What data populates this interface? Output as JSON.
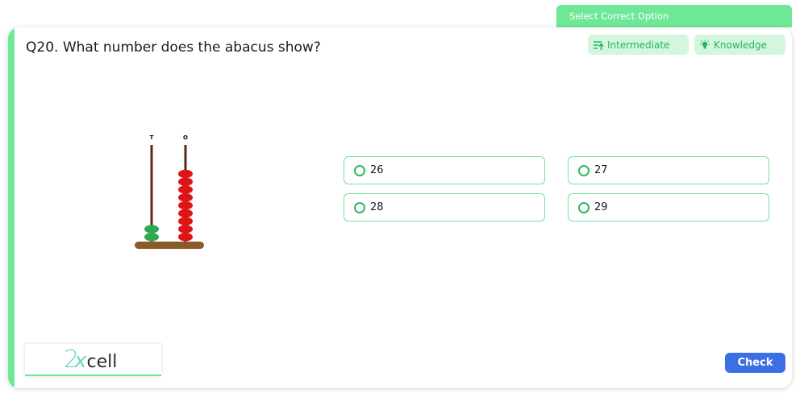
{
  "header": {
    "tab_label": "Select Correct Option"
  },
  "question": {
    "title": "Q20. What number does the abacus show?",
    "level_tag": "Intermediate",
    "type_tag": "Knowledge"
  },
  "abacus": {
    "rod_labels": [
      "T",
      "O"
    ],
    "beads": {
      "tens": 2,
      "ones": 9
    },
    "colors": {
      "tens": "#2fa84f",
      "ones": "#e01414",
      "rod": "#5a2a12",
      "base": "#8b5a2b"
    }
  },
  "options": [
    {
      "label": "26"
    },
    {
      "label": "27"
    },
    {
      "label": "28"
    },
    {
      "label": "29"
    }
  ],
  "logo": {
    "num": "2",
    "x": "x",
    "rest": "cell"
  },
  "actions": {
    "check_label": "Check"
  },
  "colors": {
    "accent": "#6ee796",
    "primary": "#3a6fe6"
  }
}
